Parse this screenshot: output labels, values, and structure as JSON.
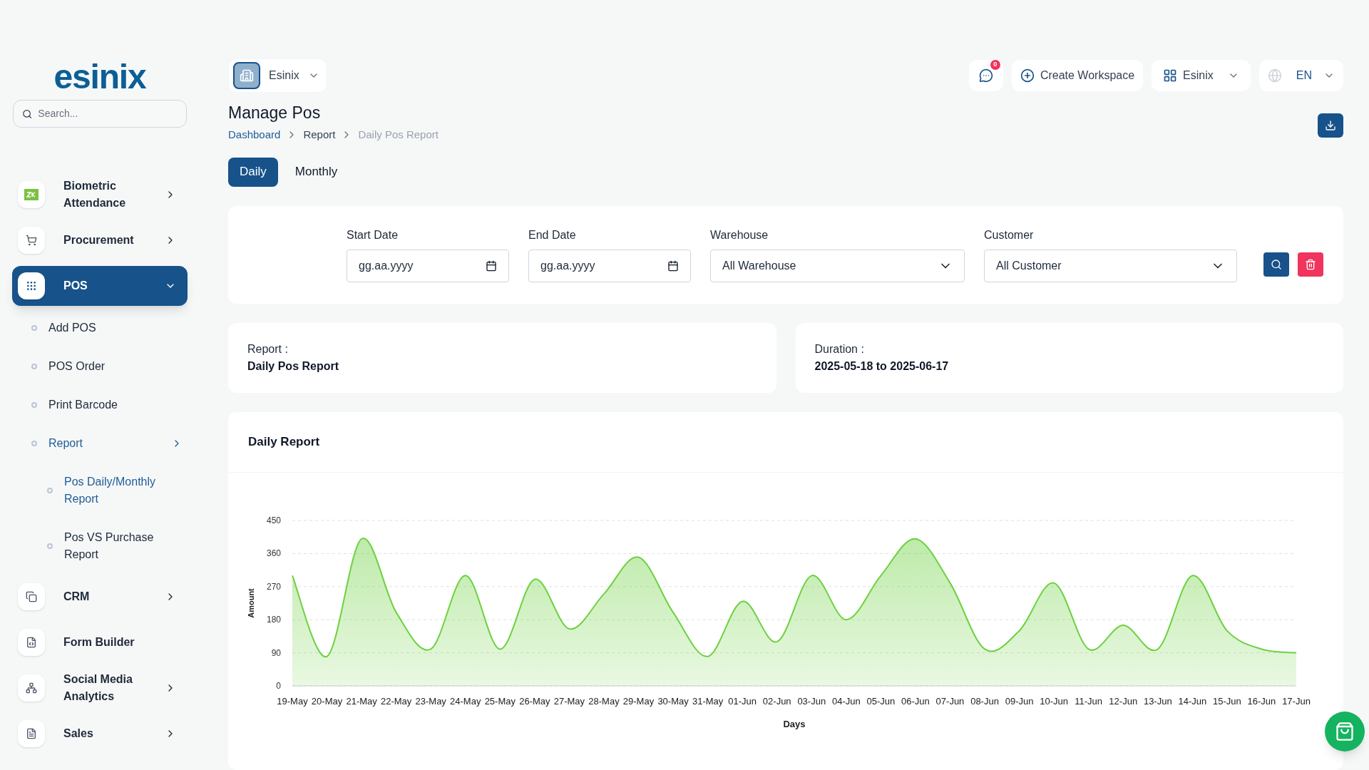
{
  "logo": "esinix",
  "search": {
    "placeholder": "Search..."
  },
  "sidebar": {
    "items": [
      {
        "label": "Biometric Attendance",
        "has_children": true,
        "expanded": false,
        "selected": false
      },
      {
        "label": "Procurement",
        "has_children": true,
        "expanded": false,
        "selected": false
      },
      {
        "label": "POS",
        "has_children": true,
        "expanded": true,
        "selected": true,
        "children": [
          {
            "label": "Add POS",
            "selected": false
          },
          {
            "label": "POS Order",
            "selected": false
          },
          {
            "label": "Print Barcode",
            "selected": false
          },
          {
            "label": "Report",
            "selected": true,
            "expanded": true,
            "children": [
              {
                "label": "Pos Daily/Monthly Report",
                "selected": true
              },
              {
                "label": "Pos VS Purchase Report",
                "selected": false
              }
            ]
          }
        ]
      },
      {
        "label": "CRM",
        "has_children": true,
        "expanded": false,
        "selected": false
      },
      {
        "label": "Form Builder",
        "has_children": false,
        "selected": false
      },
      {
        "label": "Social Media Analytics",
        "has_children": true,
        "expanded": false,
        "selected": false
      },
      {
        "label": "Sales",
        "has_children": true,
        "expanded": false,
        "selected": false
      }
    ]
  },
  "topbar": {
    "workspace": "Esinix",
    "notifications": "0",
    "create_workspace": "Create Workspace",
    "workspace_switch": "Esinix",
    "language": "EN"
  },
  "page": {
    "title": "Manage Pos",
    "breadcrumb": [
      "Dashboard",
      "Report",
      "Daily Pos Report"
    ]
  },
  "tabs": [
    {
      "label": "Daily",
      "selected": true
    },
    {
      "label": "Monthly",
      "selected": false
    }
  ],
  "filters": [
    {
      "kind": "date",
      "label": "Start Date",
      "value": "gg.aa.yyyy"
    },
    {
      "kind": "date",
      "label": "End Date",
      "value": "gg.aa.yyyy"
    },
    {
      "kind": "select",
      "label": "Warehouse",
      "value": "All Warehouse"
    },
    {
      "kind": "select",
      "label": "Customer",
      "value": "All Customer"
    }
  ],
  "info": [
    {
      "label": "Report :",
      "value": "Daily Pos Report"
    },
    {
      "label": "Duration :",
      "value": "2025-05-18 to 2025-06-17"
    }
  ],
  "report": {
    "title": "Daily Report",
    "chart_data": {
      "type": "area",
      "xlabel": "Days",
      "ylabel": "Amount",
      "categories": [
        "19-May",
        "20-May",
        "21-May",
        "22-May",
        "23-May",
        "24-May",
        "25-May",
        "26-May",
        "27-May",
        "28-May",
        "29-May",
        "30-May",
        "31-May",
        "01-Jun",
        "02-Jun",
        "03-Jun",
        "04-Jun",
        "05-Jun",
        "06-Jun",
        "07-Jun",
        "08-Jun",
        "09-Jun",
        "10-Jun",
        "11-Jun",
        "12-Jun",
        "13-Jun",
        "14-Jun",
        "15-Jun",
        "16-Jun",
        "17-Jun"
      ],
      "grid": true,
      "series": [
        {
          "color": "#6dd13f",
          "values": [
            300,
            80,
            400,
            200,
            100,
            300,
            100,
            290,
            155,
            250,
            350,
            200,
            80,
            230,
            120,
            300,
            180,
            300,
            400,
            280,
            100,
            150,
            280,
            100,
            165,
            100,
            300,
            150,
            100,
            90
          ]
        }
      ],
      "ylim": [
        0,
        450
      ],
      "yticks": [
        0,
        90,
        180,
        270,
        360,
        450
      ]
    }
  }
}
